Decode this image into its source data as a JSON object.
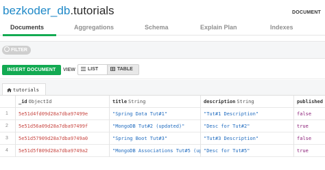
{
  "header": {
    "db_name": "bezkoder_db",
    "collection_name": ".tutorials",
    "documents_label": "DOCUMENT"
  },
  "tabs": [
    {
      "label": "Documents",
      "active": true
    },
    {
      "label": "Aggregations",
      "active": false
    },
    {
      "label": "Schema",
      "active": false
    },
    {
      "label": "Explain Plan",
      "active": false
    },
    {
      "label": "Indexes",
      "active": false
    }
  ],
  "filter": {
    "label": "FILTER",
    "value": ""
  },
  "toolbar": {
    "insert_label": "INSERT DOCUMENT",
    "view_label": "VIEW",
    "list_label": "LIST",
    "table_label": "TABLE",
    "active_view": "table"
  },
  "collection_tab": {
    "label": "tutorials"
  },
  "grid": {
    "columns": [
      {
        "name": "_id",
        "type": "ObjectId"
      },
      {
        "name": "title",
        "type": "String"
      },
      {
        "name": "description",
        "type": "String"
      },
      {
        "name": "published",
        "type": ""
      }
    ],
    "rows": [
      {
        "num": "1",
        "id": "5e51d4fd09d28a7dba97499e",
        "title": "\"Spring Data Tut#1\"",
        "description": "\"Tut#1 Description\"",
        "published": "false"
      },
      {
        "num": "2",
        "id": "5e51d56a09d28a7dba97499f",
        "title": "\"MongoDB Tut#2 (updated)\"",
        "description": "\"Desc for Tut#2\"",
        "published": "true"
      },
      {
        "num": "3",
        "id": "5e51d57909d28a7dba9749a0",
        "title": "\"Spring Boot Tut#3\"",
        "description": "\"Tut#3 Description\"",
        "published": "false"
      },
      {
        "num": "4",
        "id": "5e51d5f809d28a7dba9749a2",
        "title": "\"MongoDB Associations Tut#5 (up",
        "description": "\"Desc for Tut#5\"",
        "published": "true"
      }
    ]
  },
  "colors": {
    "accent_green": "#13aa52",
    "db_blue": "#1e88c7",
    "objectid_red": "#c7443f",
    "string_blue": "#1f6bbf",
    "bool_purple": "#8a1d77"
  },
  "icons": {
    "filter": "filter-icon",
    "list": "list-icon",
    "table": "table-icon",
    "collection": "home-icon"
  }
}
